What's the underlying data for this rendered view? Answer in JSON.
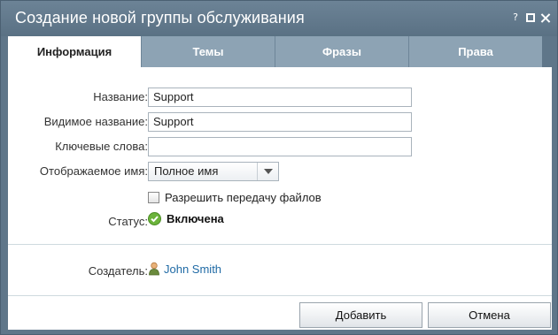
{
  "dialog": {
    "title": "Создание новой группы обслуживания",
    "controls": {
      "help": "?"
    }
  },
  "tabs": [
    {
      "label": "Информация",
      "active": true
    },
    {
      "label": "Темы",
      "active": false
    },
    {
      "label": "Фразы",
      "active": false
    },
    {
      "label": "Права",
      "active": false
    }
  ],
  "form": {
    "name_label": "Название:",
    "name_value": "Support",
    "visible_name_label": "Видимое название:",
    "visible_name_value": "Support",
    "keywords_label": "Ключевые слова:",
    "keywords_value": "",
    "display_name_label": "Отображаемое имя:",
    "display_name_value": "Полное имя",
    "allow_files_label": "Разрешить передачу файлов",
    "allow_files_checked": false,
    "status_label": "Статус:",
    "status_value": "Включена",
    "creator_label": "Создатель:",
    "creator_value": "John Smith"
  },
  "buttons": {
    "add": "Добавить",
    "cancel": "Отмена"
  },
  "colors": {
    "titlebar": "#5f7689",
    "tab_inactive": "#8da3b4",
    "link": "#1f6aa5",
    "status_ok": "#6bb33b"
  }
}
